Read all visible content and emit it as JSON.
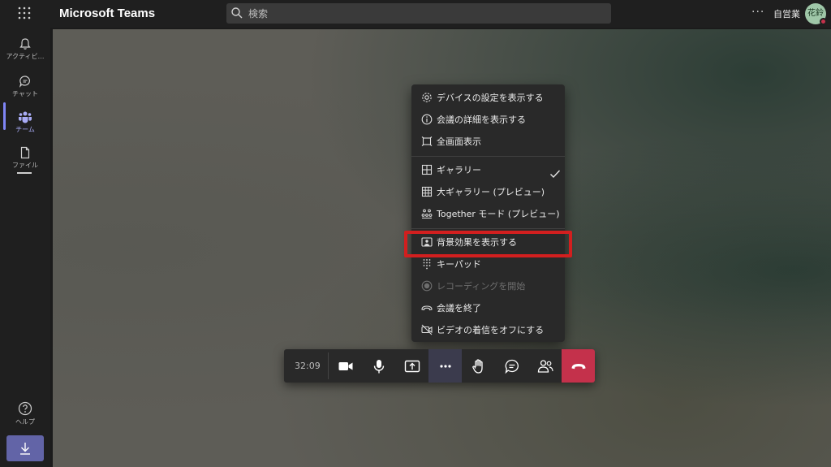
{
  "app": {
    "title": "Microsoft Teams",
    "org_name": "自営業",
    "avatar_initials": "花鈴",
    "presence_color": "#c4314b"
  },
  "search": {
    "placeholder": "検索"
  },
  "rail": {
    "items": [
      {
        "label": "アクティビ…",
        "icon": "bell-icon"
      },
      {
        "label": "チャット",
        "icon": "chat-icon"
      },
      {
        "label": "チーム",
        "icon": "teams-icon",
        "active": true
      },
      {
        "label": "ファイル",
        "icon": "file-icon"
      }
    ],
    "help_label": "ヘルプ",
    "accent": "#7f85f5"
  },
  "menu": {
    "groups": [
      [
        "デバイスの設定を表示する",
        "会議の詳細を表示する",
        "全画面表示"
      ],
      [
        "ギャラリー",
        "大ギャラリー (プレビュー)",
        "Together モード (プレビュー)"
      ],
      [
        "背景効果を表示する",
        "キーパッド",
        "レコーディングを開始",
        "会議を終了",
        "ビデオの着信をオフにする"
      ]
    ],
    "selected_item": "ギャラリー",
    "disabled_item": "レコーディングを開始",
    "highlighted_item": "背景効果を表示する",
    "highlight_color": "#d21f1f"
  },
  "controls": {
    "timer": "32:09",
    "hangup_color": "#c4314b"
  }
}
